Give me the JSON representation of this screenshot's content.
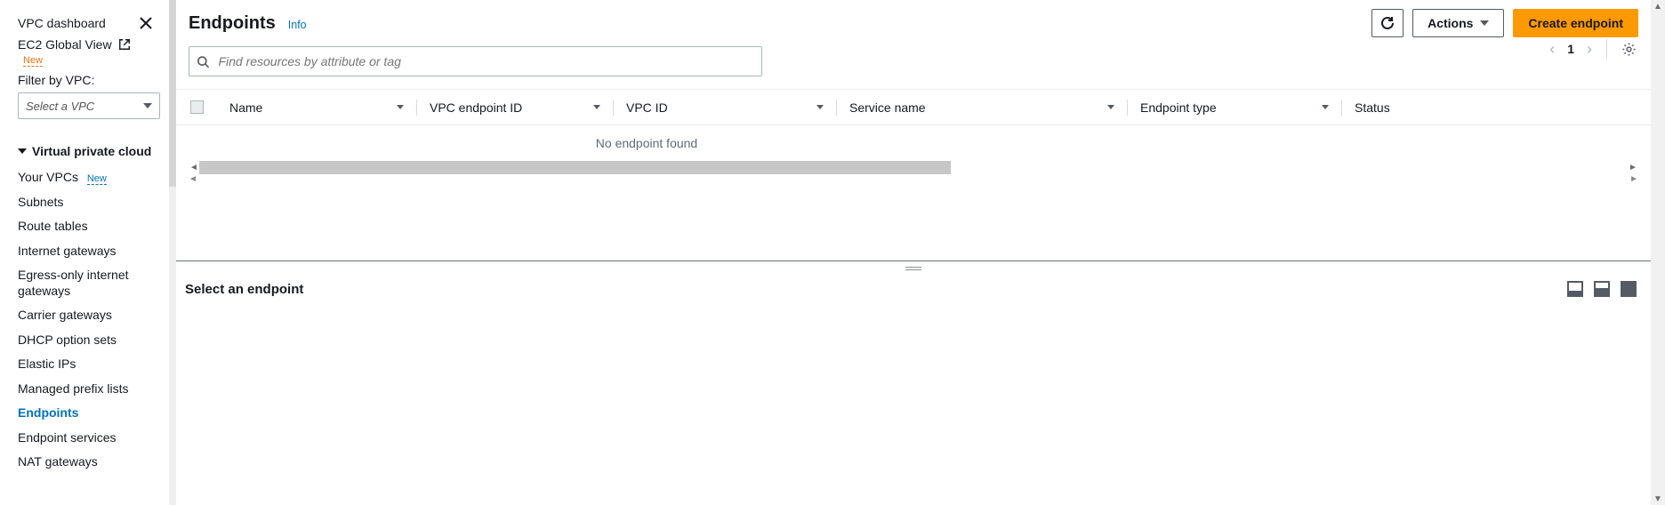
{
  "sidebar": {
    "dashboard_label": "VPC dashboard",
    "global_view_label": "EC2 Global View",
    "global_view_badge": "New",
    "filter_label": "Filter by VPC:",
    "vpc_select_placeholder": "Select a VPC",
    "section_header": "Virtual private cloud",
    "items": [
      {
        "label": "Your VPCs",
        "badge": "New"
      },
      {
        "label": "Subnets"
      },
      {
        "label": "Route tables"
      },
      {
        "label": "Internet gateways"
      },
      {
        "label": "Egress-only internet gateways"
      },
      {
        "label": "Carrier gateways"
      },
      {
        "label": "DHCP option sets"
      },
      {
        "label": "Elastic IPs"
      },
      {
        "label": "Managed prefix lists"
      },
      {
        "label": "Endpoints",
        "active": true
      },
      {
        "label": "Endpoint services"
      },
      {
        "label": "NAT gateways"
      }
    ]
  },
  "header": {
    "title": "Endpoints",
    "info": "Info",
    "refresh_aria": "Refresh",
    "actions_label": "Actions",
    "create_label": "Create endpoint"
  },
  "search": {
    "placeholder": "Find resources by attribute or tag"
  },
  "pager": {
    "page": "1"
  },
  "table": {
    "columns": {
      "name": "Name",
      "vpc_endpoint_id": "VPC endpoint ID",
      "vpc_id": "VPC ID",
      "service_name": "Service name",
      "endpoint_type": "Endpoint type",
      "status": "Status"
    },
    "empty_message": "No endpoint found"
  },
  "detail": {
    "empty_title": "Select an endpoint"
  }
}
